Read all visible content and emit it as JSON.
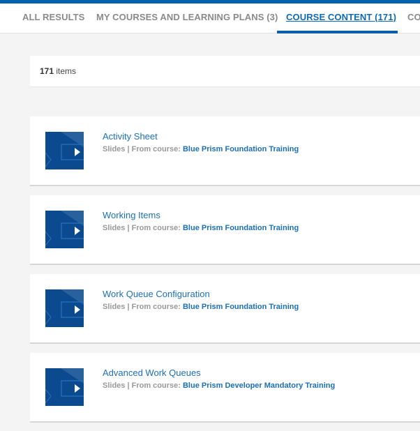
{
  "tabs": [
    {
      "label": "ALL RESULTS"
    },
    {
      "label": "MY COURSES AND LEARNING PLANS (3)"
    },
    {
      "label": "COURSE CONTENT (171)",
      "active": true
    },
    {
      "label": "CO"
    }
  ],
  "results": {
    "count": "171",
    "count_suffix": "items"
  },
  "items": [
    {
      "title": "Activity Sheet",
      "type": "Slides",
      "separator": "|",
      "from_label": "From course:",
      "course": "Blue Prism Foundation Training"
    },
    {
      "title": "Working Items",
      "type": "Slides",
      "separator": "|",
      "from_label": "From course:",
      "course": "Blue Prism Foundation Training"
    },
    {
      "title": "Work Queue Configuration",
      "type": "Slides",
      "separator": "|",
      "from_label": "From course:",
      "course": "Blue Prism Foundation Training"
    },
    {
      "title": "Advanced Work Queues",
      "type": "Slides",
      "separator": "|",
      "from_label": "From course:",
      "course": "Blue Prism Developer Mandatory Training"
    }
  ]
}
